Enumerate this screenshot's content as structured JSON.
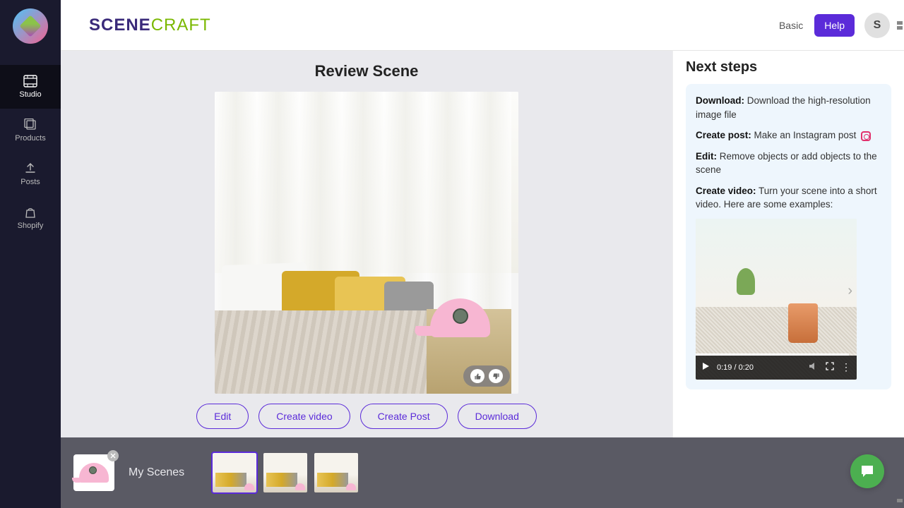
{
  "brand": {
    "part1": "SCENE",
    "part2": "CRAFT"
  },
  "header": {
    "plan": "Basic",
    "help": "Help",
    "avatar_initial": "S"
  },
  "nav": {
    "studio": "Studio",
    "products": "Products",
    "posts": "Posts",
    "shopify": "Shopify"
  },
  "main": {
    "title": "Review Scene",
    "actions": {
      "edit": "Edit",
      "create_video": "Create video",
      "create_post": "Create Post",
      "download": "Download"
    }
  },
  "right": {
    "title": "Next steps",
    "steps": {
      "download_label": "Download:",
      "download_text": " Download the high-resolution image file",
      "createpost_label": "Create post:",
      "createpost_text": " Make an Instagram post",
      "edit_label": "Edit:",
      "edit_text": " Remove objects or add objects to the scene",
      "createvideo_label": "Create video:",
      "createvideo_text": " Turn your scene into a short video. Here are some examples:"
    },
    "video": {
      "time": "0:19 / 0:20"
    }
  },
  "bottom": {
    "label": "My Scenes"
  }
}
